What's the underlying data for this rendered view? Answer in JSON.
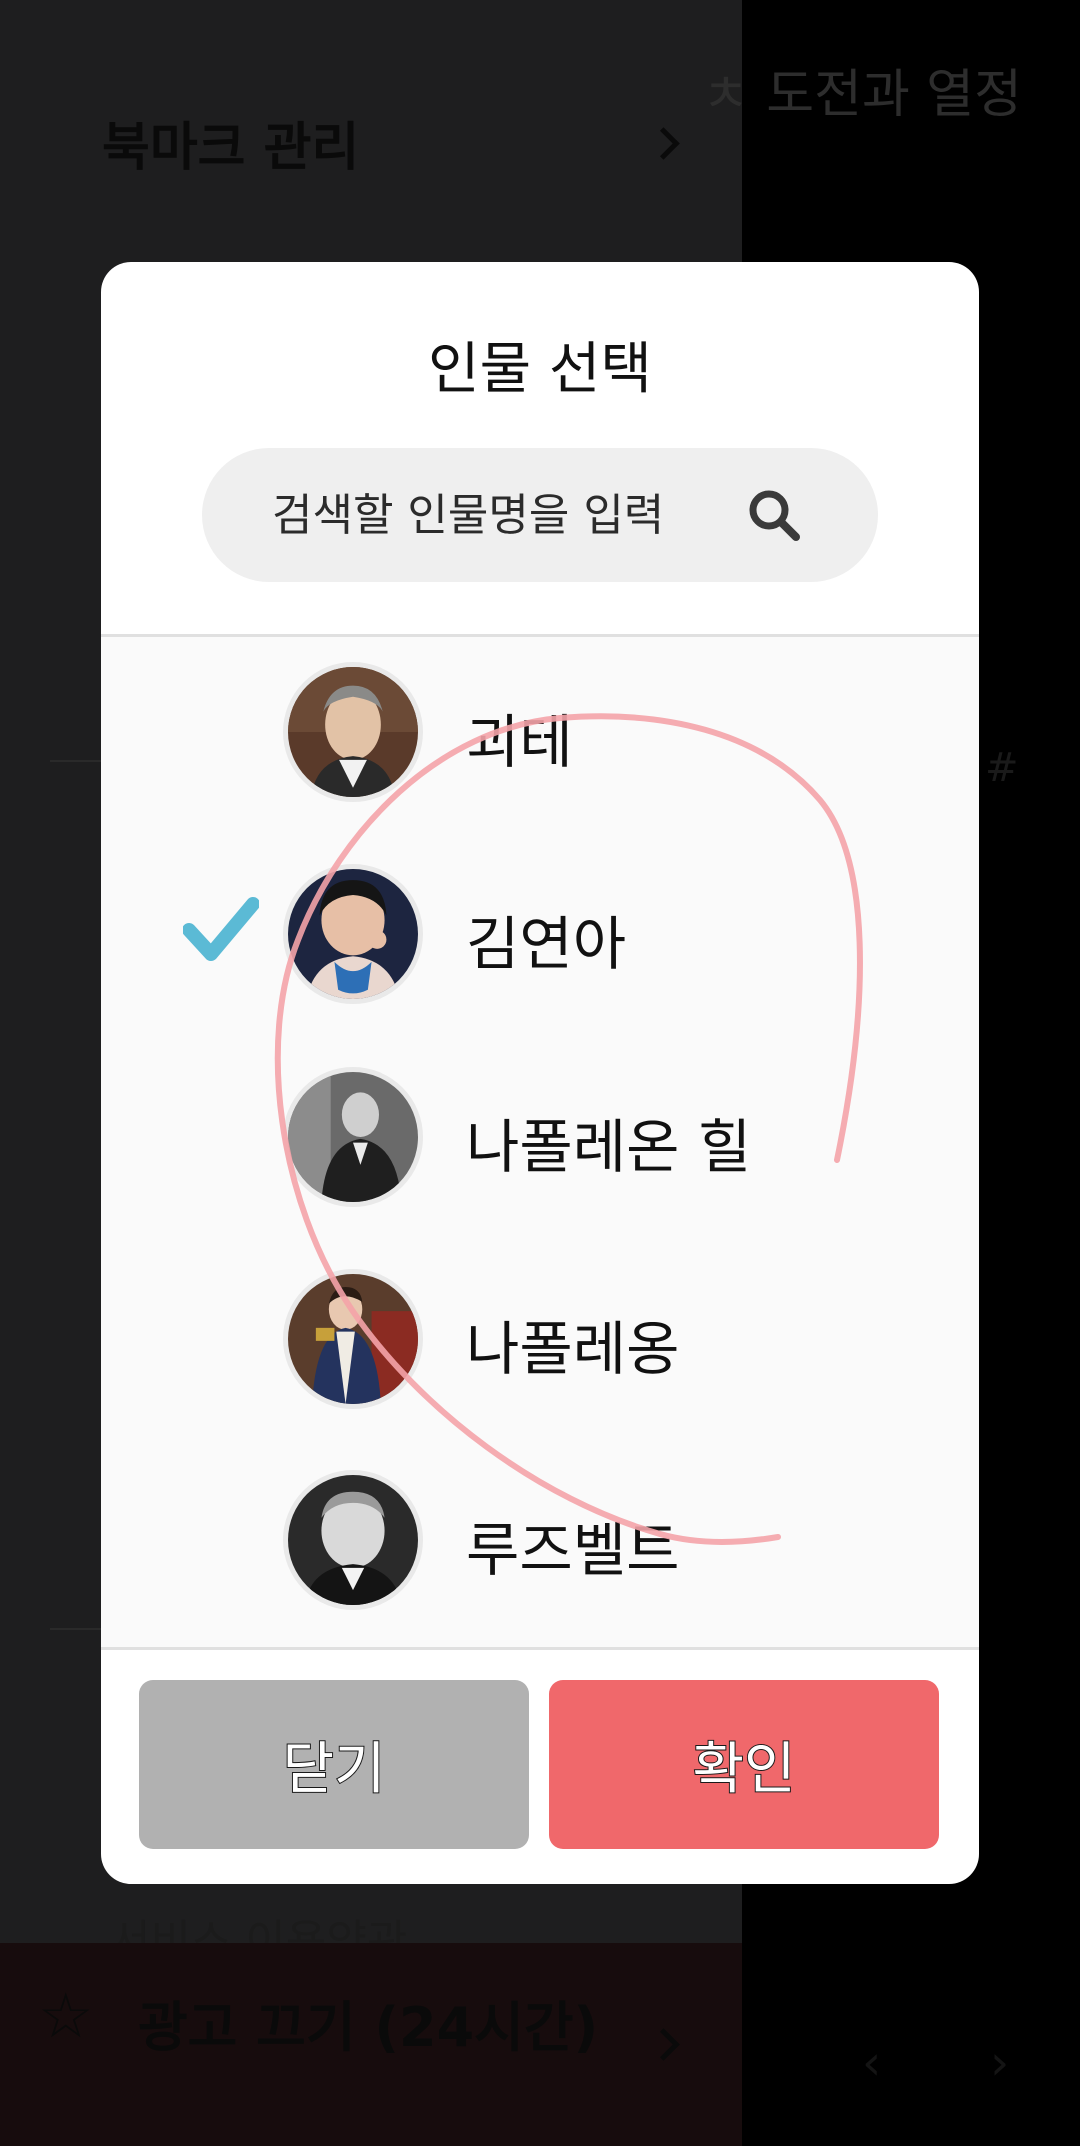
{
  "background": {
    "title_fragment": "ㅊ 도전과 열정",
    "menu_bookmark_label": "북마크 관리",
    "menu_peek_label": "서비스 이용약관",
    "hint_glyph": "#",
    "ad_label": "광고 끄기 (24시간)",
    "ad_star_icon": "☆",
    "nav_prev": "‹",
    "nav_next": "›"
  },
  "dialog": {
    "title": "인물 선택",
    "search": {
      "placeholder": "검색할 인물명을 입력",
      "value": ""
    },
    "people": [
      {
        "name": "괴테",
        "selected": false,
        "avatar": "goethe-portrait"
      },
      {
        "name": "김연아",
        "selected": true,
        "avatar": "kim-yuna-photo"
      },
      {
        "name": "나폴레온 힐",
        "selected": false,
        "avatar": "napoleon-hill-photo"
      },
      {
        "name": "나폴레옹",
        "selected": false,
        "avatar": "napoleon-portrait"
      },
      {
        "name": "루즈벨트",
        "selected": false,
        "avatar": "roosevelt-photo"
      }
    ],
    "buttons": {
      "close_label": "닫기",
      "confirm_label": "확인"
    }
  },
  "colors": {
    "confirm": "#f0686b",
    "close": "#b1b1b1",
    "check": "#5bbad5",
    "scribble": "#f4a3a8"
  }
}
